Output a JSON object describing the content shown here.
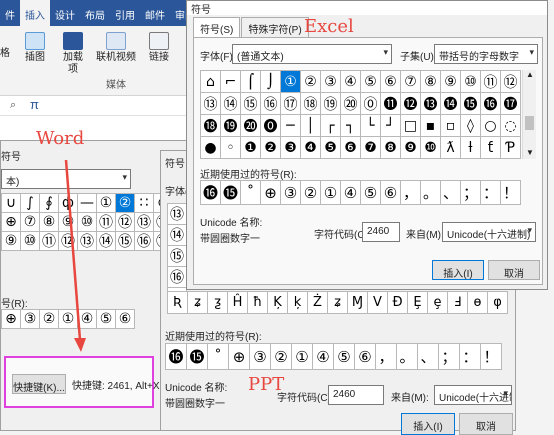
{
  "word": {
    "tabs": [
      "件",
      "插入",
      "设计",
      "布局",
      "引用",
      "邮件",
      "审阅"
    ],
    "ribbon": {
      "insert_illustration": "插图",
      "addins": "加载\n项",
      "online_video": "联机视频",
      "media_group": "媒体",
      "link": "链接",
      "left_fragment": "格"
    },
    "qat_glyph": "π",
    "dialog": {
      "title_fragment": "符号",
      "font_value": "本)",
      "grid_rows": [
        [
          "∪",
          "∫",
          "∮",
          "ф",
          "—",
          "①",
          "②",
          "∷",
          "⊙"
        ],
        [
          "⊕",
          "⑦",
          "⑧",
          "⑨",
          "⑩",
          "⑪",
          "⑫",
          "⑬",
          "⑭"
        ],
        [
          "⑨",
          "⑩",
          "⑪",
          "⑫",
          "⑬",
          "⑭",
          "⑮",
          "⑯",
          "⑰"
        ]
      ],
      "recent_label_fragment": "号(R):",
      "recent": [
        "⊕",
        "③",
        "②",
        "①",
        "④",
        "⑤",
        "⑥"
      ],
      "shortcut_button": "快捷键(K)...",
      "shortcut_text": "快捷键: 2461, Alt+X"
    }
  },
  "ppt": {
    "title_fragment": "符号",
    "font_label": "字体(",
    "grid_left": [
      "⑬",
      "⑭",
      "⑮",
      "⑯",
      "•"
    ],
    "phonetic_row": [
      "Ʀ",
      "ʑ",
      "ƺ",
      "Ĥ",
      "ħ",
      "Ķ",
      "ķ",
      "Ż",
      "ʑ",
      "Ɱ",
      "Ⅴ",
      "Ɖ",
      "Ȩ",
      "ȩ",
      "Ⅎ",
      "ɵ",
      "φ"
    ],
    "recent_label": "近期使用过的符号(R):",
    "recent": [
      "⓰",
      "⓯",
      "˚",
      "⊕",
      "③",
      "②",
      "①",
      "④",
      "⑤",
      "⑥",
      "，",
      "。",
      "、",
      "；",
      "：",
      "！"
    ],
    "unicode_name_label": "Unicode 名称:",
    "unicode_name": "带圆圈数字一",
    "char_code_label": "字符代码(C):",
    "char_code": "2460",
    "from_label": "来自(M):",
    "from_value": "Unicode(十六进制)",
    "insert_button": "插入(I)",
    "cancel_button": "取消"
  },
  "excel": {
    "title_fragment": "符号",
    "tabs": [
      "符号(S)",
      "特殊字符(P)"
    ],
    "font_label": "字体(F):",
    "font_value": "(普通文本)",
    "subset_label": "子集(U):",
    "subset_value": "带括号的字母数字",
    "grid": [
      [
        "⌂",
        "⌐",
        "⌠",
        "⌡",
        "①",
        "②",
        "③",
        "④",
        "⑤",
        "⑥",
        "⑦",
        "⑧",
        "⑨",
        "⑩",
        "⑪",
        "⑫"
      ],
      [
        "⑬",
        "⑭",
        "⑮",
        "⑯",
        "⑰",
        "⑱",
        "⑲",
        "⑳",
        "⓪",
        "⓫",
        "⓬",
        "⓭",
        "⓮",
        "⓯",
        "⓰",
        "⓱"
      ],
      [
        "⓲",
        "⓳",
        "⓴",
        "⓿",
        "─",
        "│",
        "┌",
        "┐",
        "└",
        "┘",
        "□",
        "▪",
        "▫",
        "◊",
        "○",
        "◌"
      ],
      [
        "●",
        "◦",
        "❶",
        "❷",
        "❸",
        "❹",
        "❺",
        "❻",
        "❼",
        "❽",
        "❾",
        "❿",
        "ƛ",
        "ƚ",
        "ƭ",
        "Ƥ"
      ]
    ],
    "recent_label": "近期使用过的符号(R):",
    "recent": [
      "⓰",
      "⓯",
      "˚",
      "⊕",
      "③",
      "②",
      "①",
      "④",
      "⑤",
      "⑥",
      "，",
      "。",
      "、",
      "；",
      "：",
      "！"
    ],
    "unicode_name_label": "Unicode 名称:",
    "unicode_name": "带圆圈数字一",
    "char_code_label": "字符代码(C):",
    "char_code": "2460",
    "from_label": "来自(M):",
    "from_value": "Unicode(十六进制)",
    "insert_button": "插入(I)",
    "cancel_button": "取消"
  },
  "annotations": {
    "excel": "Excel",
    "word": "Word",
    "ppt": "PPT"
  },
  "colors": {
    "word_blue": "#2b579a",
    "selection_blue": "#0078d7",
    "annotation_red": "#e8473f",
    "highlight_magenta": "#e040e0"
  }
}
